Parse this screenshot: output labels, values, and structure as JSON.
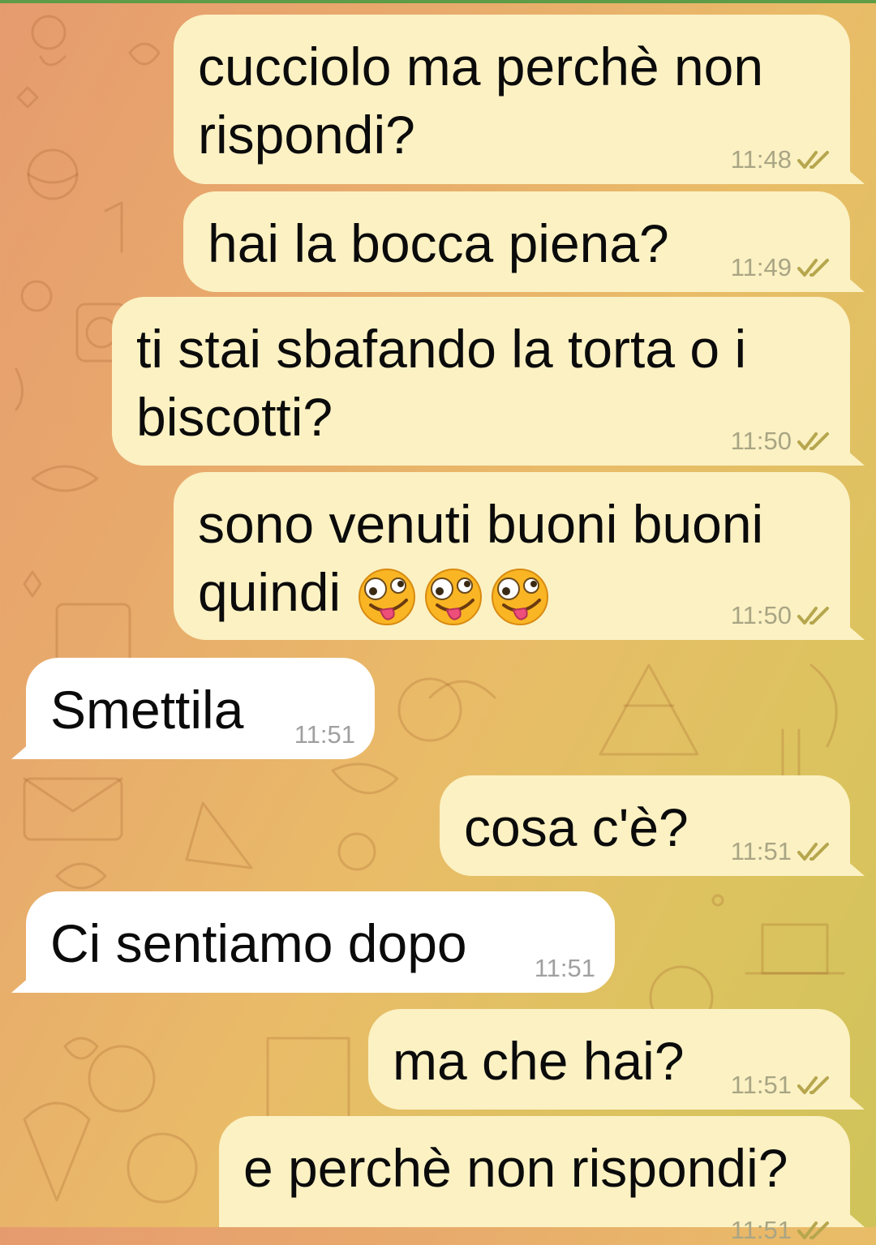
{
  "chat": {
    "messages": [
      {
        "id": "m1",
        "direction": "out",
        "text": "cucciolo ma perchè non\nrispondi?",
        "time": "11:48",
        "status": "read"
      },
      {
        "id": "m2",
        "direction": "out",
        "text": "hai la bocca piena?",
        "time": "11:49",
        "status": "read"
      },
      {
        "id": "m3",
        "direction": "out",
        "text": "ti stai sbafando la torta o i\nbiscotti?",
        "time": "11:50",
        "status": "read"
      },
      {
        "id": "m4",
        "direction": "out",
        "text": "sono venuti buoni buoni\nquindi ",
        "emoji": [
          "zany-face",
          "zany-face",
          "zany-face"
        ],
        "time": "11:50",
        "status": "read"
      },
      {
        "id": "m5",
        "direction": "in",
        "text": "Smettila",
        "time": "11:51"
      },
      {
        "id": "m6",
        "direction": "out",
        "text": "cosa c'è?",
        "time": "11:51",
        "status": "read"
      },
      {
        "id": "m7",
        "direction": "in",
        "text": "Ci sentiamo dopo",
        "time": "11:51"
      },
      {
        "id": "m8",
        "direction": "out",
        "text": "ma che hai?",
        "time": "11:51",
        "status": "read"
      },
      {
        "id": "m9",
        "direction": "out",
        "text": "e perchè non rispondi?",
        "time": "11:51",
        "status": "read"
      }
    ]
  },
  "colors": {
    "outgoing_bubble": "#fbf1c3",
    "incoming_bubble": "#ffffff",
    "read_ticks": "#b6a64d",
    "wallpaper_start": "#e69b6e",
    "wallpaper_end": "#cfc35a"
  }
}
